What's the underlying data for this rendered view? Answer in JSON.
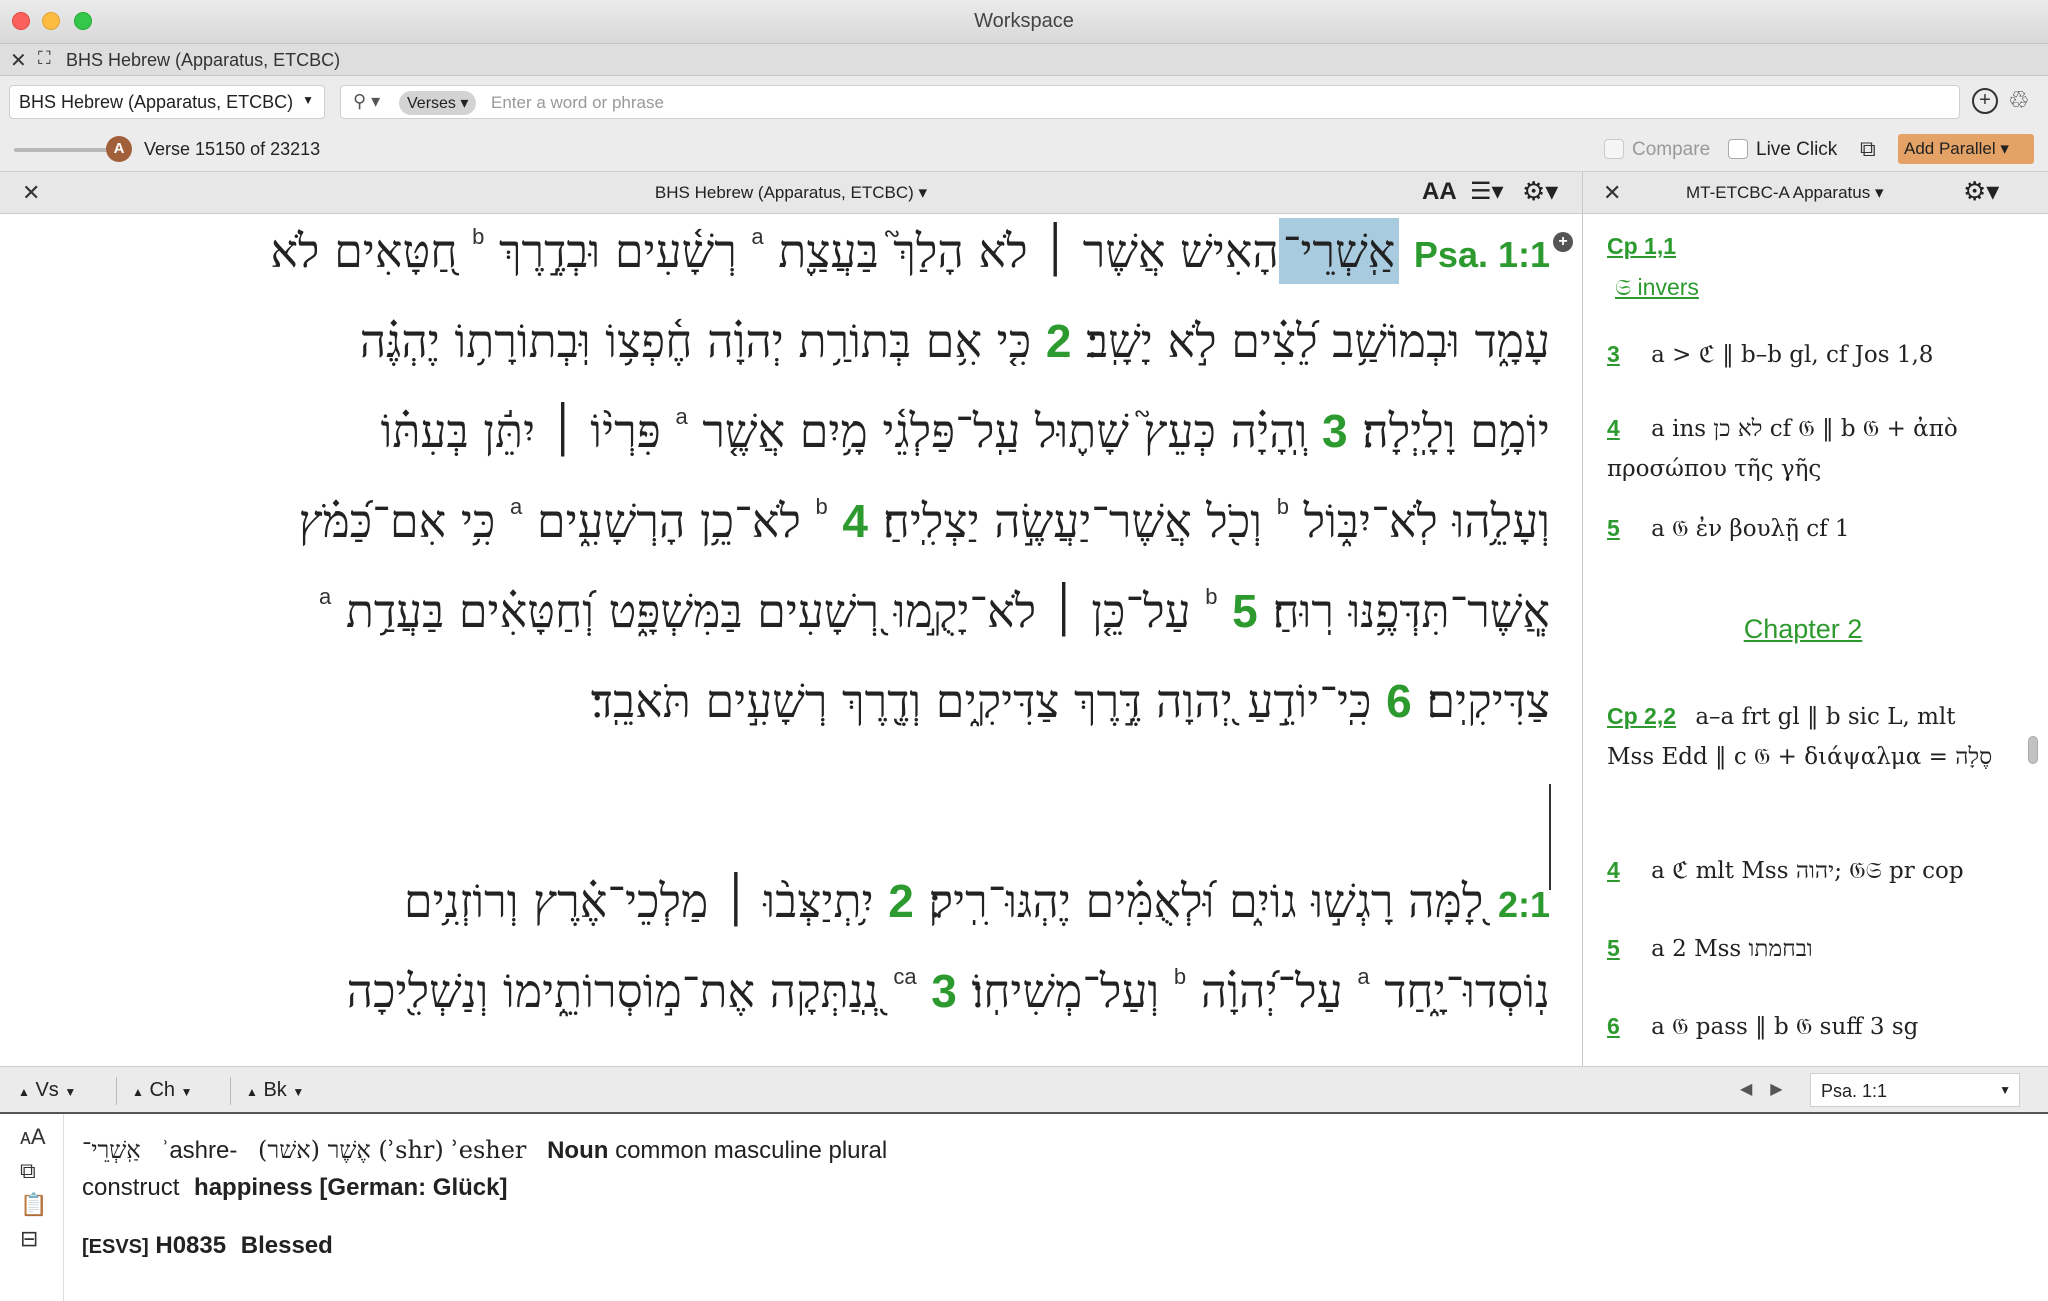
{
  "window": {
    "title": "Workspace"
  },
  "doc_tab": {
    "title": "BHS Hebrew (Apparatus, ETCBC)"
  },
  "search": {
    "resource": "BHS Hebrew (Apparatus, ETCBC)",
    "scope": "Verses",
    "placeholder": "Enter a word or phrase"
  },
  "toolbar": {
    "slider_badge": "A",
    "verse_status": "Verse 15150 of 23213",
    "compare_label": "Compare",
    "live_click_label": "Live Click",
    "add_parallel_label": "Add Parallel"
  },
  "main_panel": {
    "title": "BHS Hebrew (Apparatus, ETCBC)",
    "font_icon": "AA",
    "lines": [
      {
        "ref": "Psa. 1:1",
        "highlight": "אַֽשְׁרֵי־",
        "text": "הָאִישׁ אֲשֶׁר ׀ לֹא הָלַךְ֮ בַּעֲצַ֪ת",
        "sup_a": "a",
        "text2": "רְשָׁ֫עִים וּבְדֶ֣רֶךְ",
        "sup_b": "b",
        "text3": "חַ֭טָּאִים לֹא"
      },
      {
        "text": "עָמָ֑ד וּבְמוֹשַׁ֥ב לֵ֝צִ֗ים לֹ֣א יָשָֽׁב׃",
        "vnum": "2",
        "text2": "כִּ֤י אִ֥ם בְּתוֹרַ֥ת יְהוָ֗ה חֶ֫פְצ֥וֹ וּֽבְתוֹרָת֥וֹ יֶהְגֶּ֗ה"
      },
      {
        "text": "יוֹמָ֥ם וָלָֽיְלָה׃",
        "vnum": "3",
        "text2": "וְֽהָיָ֗ה כְּעֵץ֮ שָׁת֪וּל עַֽל־פַּלְגֵ֫י מָ֥יִם אֲשֶׁ֤ר",
        "sup_a": "a",
        "text3": "פִּרְי֨וֹ ׀ יִתֵּ֬ן בְּעִתּ֗וֹ"
      },
      {
        "text": "וְעָלֵ֥הוּ לֹֽא־יִבּ֑וֹל",
        "sup_b": "b",
        "text2": "וְכֹ֖ל אֲשֶׁר־יַעֲשֶׂ֣ה יַצְלִֽיחַ׃",
        "sup_b2": "b",
        "vnum": "4",
        "text3": "לֹא־כֵ֥ן הָרְשָׁעִ֑ים",
        "sup_a": "a",
        "text4": "כִּ֥י אִם־כַּ֝מֹּ֗ץ"
      },
      {
        "text": "אֲ‍ֽשֶׁר־תִּדְּפֶ֥נּוּ רֽוּחַ׃",
        "sup_b": "b",
        "vnum": "5",
        "text2": "עַל־כֵּ֤ן ׀ לֹא־יָקֻ֣מוּ רְ֭שָׁעִים בַּמִּשְׁפָּ֑ט וְ֝חַטָּאִ֗ים בַּעֲדַ֥ת",
        "sup_a": "a"
      },
      {
        "text": "צַדִּיקִֽים׃",
        "vnum": "6",
        "text2": "כִּֽי־יוֹדֵ֣עַ יְ֭הוָה דֶּ֣רֶךְ צַדִּיקִ֑ים וְדֶ֖רֶךְ רְשָׁעִ֣ים תֹּאבֵֽד׃"
      },
      {
        "ref": "2:1",
        "text": "לָ֭מָּה רָגְשׁ֣וּ גוֹיִ֑ם וּ֝לְאֻמִּ֗ים יֶהְגּוּ־רִֽיק׃",
        "vnum": "2",
        "text2": "יִ֥תְיַצְּב֨וּ ׀ מַלְכֵי־אֶ֗רֶץ וְרוֹזְנִ֥ים"
      },
      {
        "text": "נֽוֹסְדוּ־יָ֑חַד",
        "sup_a": "a",
        "text2": "עַל־יְ֝הוָ֗ה",
        "sup_b": "b",
        "text3": "וְעַל־מְשִׁיחֽוֹ׃",
        "sup_ca": "ca",
        "vnum": "3",
        "text4": "נְֽ֭נַתְּקָה אֶת־מ֣וֹסְרוֹתֵ֑ימוֹ וְנַשְׁלִ֖יכָה"
      }
    ]
  },
  "apparatus": {
    "title": "MT-ETCBC-A Apparatus",
    "entries": [
      {
        "label": "Cp 1,1",
        "text": "𝔖 invers"
      },
      {
        "label": "3",
        "text": "a > ℭ ‖ b–b gl, cf Jos 1,8"
      },
      {
        "label": "4",
        "text": "a ins לא כן cf 𝔊 ‖ b 𝔊 + ἀπὸ προσώπου τῆς γῆς"
      },
      {
        "label": "5",
        "text": "a 𝔊 ἐν βουλῇ cf 1"
      }
    ],
    "chapter_heading": "Chapter 2",
    "entries2": [
      {
        "label": "Cp 2,2",
        "text": "a–a frt gl ‖ b sic L, mlt Mss Edd ‖ c 𝔊 + διάψαλμα = סֶלָה"
      },
      {
        "label": "4",
        "text": "a ℭ mlt Mss יהוה; 𝔊𝔖 pr cop"
      },
      {
        "label": "5",
        "text": "a 2 Mss ובחמתו"
      },
      {
        "label": "6",
        "text": "a 𝔊 pass ‖ b 𝔊 suff 3 sg"
      }
    ]
  },
  "nav": {
    "verse_label": "Vs",
    "chapter_label": "Ch",
    "book_label": "Bk",
    "reference": "Psa. 1:1"
  },
  "info": {
    "word": "אַֽשְׁרֵי־",
    "translit": "ʾashre-",
    "lemma": "אֶשֶׁר (אשׁר) (ʾshr) ʾesher",
    "pos": "Noun",
    "morph": "common masculine plural",
    "morph2": "construct",
    "gloss": "happiness [German: Glück]",
    "esvs_tag": "[ESVS]",
    "strongs": "H0835",
    "esvs_gloss": "Blessed"
  }
}
